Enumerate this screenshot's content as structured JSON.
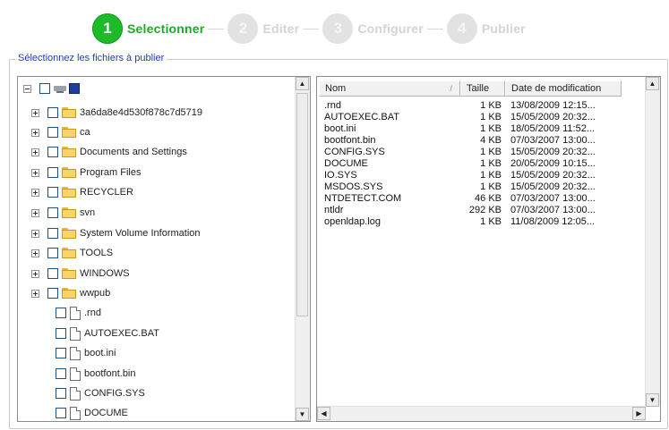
{
  "wizard": {
    "steps": [
      {
        "number": "1",
        "label": "Selectionner",
        "state": "active"
      },
      {
        "number": "2",
        "label": "Editer",
        "state": "inactive"
      },
      {
        "number": "3",
        "label": "Configurer",
        "state": "inactive"
      },
      {
        "number": "4",
        "label": "Publier",
        "state": "inactive"
      }
    ]
  },
  "group": {
    "legend": "Sélectionnez les fichiers à publier"
  },
  "tree": {
    "items": [
      {
        "label": "",
        "type": "root"
      },
      {
        "label": "3a6da8e4d530f878c7d5719",
        "type": "folder"
      },
      {
        "label": "ca",
        "type": "folder"
      },
      {
        "label": "Documents and Settings",
        "type": "folder"
      },
      {
        "label": "Program Files",
        "type": "folder"
      },
      {
        "label": "RECYCLER",
        "type": "folder"
      },
      {
        "label": "svn",
        "type": "folder"
      },
      {
        "label": "System Volume Information",
        "type": "folder"
      },
      {
        "label": "TOOLS",
        "type": "folder"
      },
      {
        "label": "WINDOWS",
        "type": "folder"
      },
      {
        "label": "wwpub",
        "type": "folder"
      },
      {
        "label": ".rnd",
        "type": "file"
      },
      {
        "label": "AUTOEXEC.BAT",
        "type": "file"
      },
      {
        "label": "boot.ini",
        "type": "file"
      },
      {
        "label": "bootfont.bin",
        "type": "file"
      },
      {
        "label": "CONFIG.SYS",
        "type": "file"
      },
      {
        "label": "DOCUME",
        "type": "file"
      }
    ]
  },
  "list": {
    "columns": [
      "Nom",
      "Taille",
      "Date de modification"
    ],
    "rows": [
      {
        "name": ".rnd",
        "size": "1 KB",
        "date": "13/08/2009 12:15..."
      },
      {
        "name": "AUTOEXEC.BAT",
        "size": "1 KB",
        "date": "15/05/2009 20:32..."
      },
      {
        "name": "boot.ini",
        "size": "1 KB",
        "date": "18/05/2009 11:52..."
      },
      {
        "name": "bootfont.bin",
        "size": "4 KB",
        "date": "07/03/2007 13:00..."
      },
      {
        "name": "CONFIG.SYS",
        "size": "1 KB",
        "date": "15/05/2009 20:32..."
      },
      {
        "name": "DOCUME",
        "size": "1 KB",
        "date": "20/05/2009 10:15..."
      },
      {
        "name": "IO.SYS",
        "size": "1 KB",
        "date": "15/05/2009 20:32..."
      },
      {
        "name": "MSDOS.SYS",
        "size": "1 KB",
        "date": "15/05/2009 20:32..."
      },
      {
        "name": "NTDETECT.COM",
        "size": "46 KB",
        "date": "07/03/2007 13:00..."
      },
      {
        "name": "ntldr",
        "size": "292 KB",
        "date": "07/03/2007 13:00..."
      },
      {
        "name": "openldap.log",
        "size": "1 KB",
        "date": "11/08/2009 12:05..."
      }
    ]
  },
  "scroll": {
    "up": "▲",
    "down": "▼",
    "left": "◀",
    "right": "▶"
  }
}
